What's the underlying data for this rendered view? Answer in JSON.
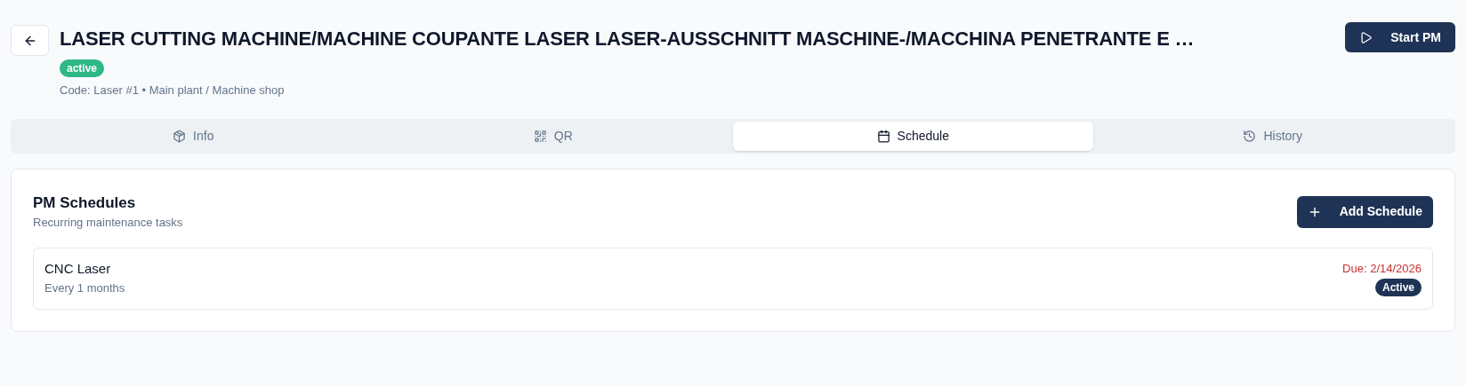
{
  "header": {
    "title": "LASER CUTTING MACHINE/MACHINE COUPANTE LASER LASER-AUSSCHNITT MASCHINE-/MACCHINA PENETRANTE E …",
    "status": "active",
    "meta": "Code: Laser #1 • Main plant / Machine shop",
    "action": "Start PM"
  },
  "tabs": [
    {
      "label": "Info",
      "kind": "package",
      "selected": false
    },
    {
      "label": "QR",
      "kind": "qr",
      "selected": false
    },
    {
      "label": "Schedule",
      "kind": "calendar",
      "selected": true
    },
    {
      "label": "History",
      "kind": "history",
      "selected": false
    }
  ],
  "card": {
    "title": "PM Schedules",
    "subtitle": "Recurring maintenance tasks",
    "action": "Add Schedule",
    "schedules": [
      {
        "name": "CNC Laser",
        "interval": "Every 1 months",
        "due": "Due: 2/14/2026",
        "overdue": true,
        "status": "Active"
      }
    ]
  }
}
